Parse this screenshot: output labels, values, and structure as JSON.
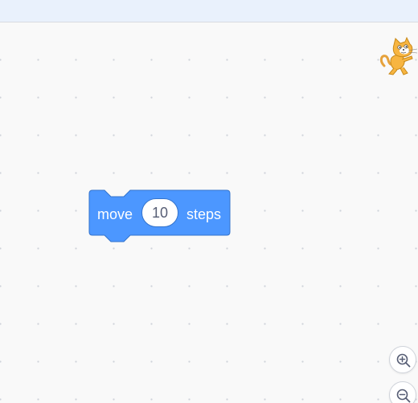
{
  "block": {
    "label_before": "move",
    "input_value": "10",
    "label_after": "steps"
  },
  "colors": {
    "block_fill": "#4c97ff",
    "block_stroke": "#3373cc",
    "top_bar": "#e9f1fc",
    "workspace": "#f9f9f9"
  },
  "icons": {
    "sprite": "cat-sprite-icon",
    "zoom_in": "zoom-in-icon",
    "zoom_out": "zoom-out-icon"
  }
}
